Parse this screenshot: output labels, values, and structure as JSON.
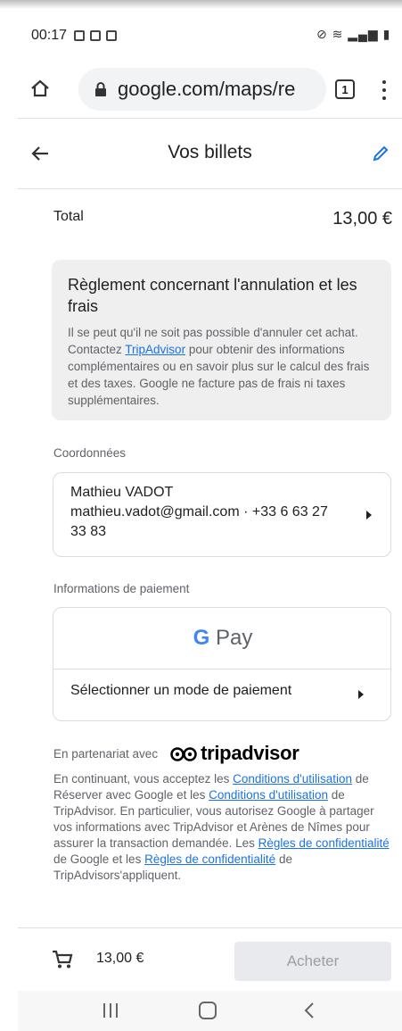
{
  "status_bar": {
    "time": "00:17"
  },
  "browser": {
    "url": "google.com/maps/re",
    "tab_count": "1"
  },
  "header": {
    "title": "Vos billets"
  },
  "total": {
    "label": "Total",
    "value": "13,00 €"
  },
  "policy": {
    "title": "Règlement concernant l'annulation et les frais",
    "text_before_link": "Il se peut qu'il ne soit pas possible d'annuler cet achat. Contactez ",
    "link": "TripAdvisor",
    "text_after_link": " pour obtenir des informations complémentaires ou en savoir plus sur le calcul des frais et des taxes. Google ne facture pas de frais ni taxes supplémentaires."
  },
  "contact": {
    "section_label": "Coordonnées",
    "name": "Mathieu VADOT",
    "details": "mathieu.vadot@gmail.com · +33 6 63 27 33 83"
  },
  "payment": {
    "section_label": "Informations de paiement",
    "gpay_g": "G",
    "gpay_label": "Pay",
    "select_method": "Sélectionner un mode de paiement"
  },
  "partner": {
    "label": "En partenariat avec",
    "brand": "tripadvisor"
  },
  "legal": {
    "t1": "En continuant, vous acceptez les ",
    "l1": "Conditions d'utilisation",
    "t2": " de Réserver avec Google et les ",
    "l2": "Conditions d'utilisation",
    "t3": " de TripAdvisor. En particulier, vous autorisez Google à partager vos informations avec TripAdvisor et Arènes de Nîmes pour assurer la transaction demandée. Les ",
    "l3": "Règles de confidentialité",
    "t4": " de Google et les ",
    "l4": "Règles de confidentialité",
    "t5": " de TripAdvisors'appliquent."
  },
  "bottom": {
    "price": "13,00 €",
    "buy_label": "Acheter"
  },
  "colors": {
    "link": "#1a73e8",
    "edit_icon": "#1a73e8",
    "gpay_g": "#4285f4"
  }
}
